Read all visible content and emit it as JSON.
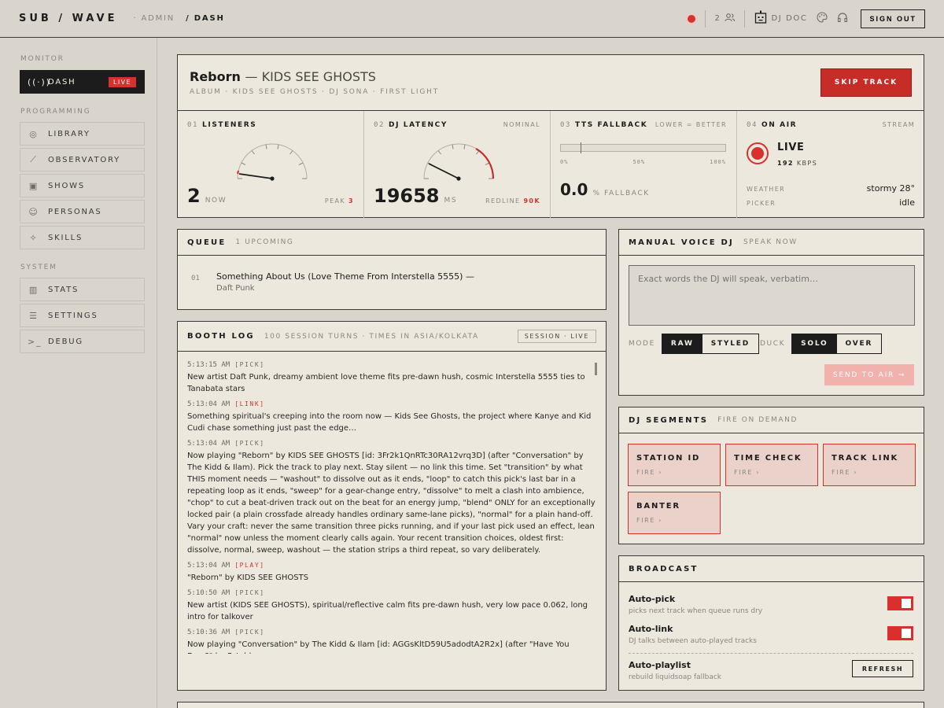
{
  "header": {
    "brand": "SUB / WAVE",
    "crumbs": [
      "· ADMIN",
      "/ DASH"
    ],
    "listener_count": "2",
    "dj_label": "DJ DOC",
    "sign_out": "SIGN OUT"
  },
  "sidebar": {
    "sections": [
      "MONITOR",
      "PROGRAMMING",
      "SYSTEM"
    ],
    "items": [
      {
        "label": "DASH",
        "icon": "broadcast-icon",
        "badge": "LIVE",
        "active": true
      },
      {
        "label": "LIBRARY",
        "icon": "vinyl-icon"
      },
      {
        "label": "OBSERVATORY",
        "icon": "telescope-icon"
      },
      {
        "label": "SHOWS",
        "icon": "calendar-icon"
      },
      {
        "label": "PERSONAS",
        "icon": "mask-icon"
      },
      {
        "label": "SKILLS",
        "icon": "sparkle-icon"
      },
      {
        "label": "STATS",
        "icon": "bar-chart-icon"
      },
      {
        "label": "SETTINGS",
        "icon": "sliders-icon"
      },
      {
        "label": "DEBUG",
        "icon": "terminal-icon"
      }
    ]
  },
  "now_playing": {
    "title": "Reborn",
    "artist": "— KIDS SEE GHOSTS",
    "meta": "ALBUM · KIDS SEE GHOSTS · DJ SONA · FIRST LIGHT",
    "skip_label": "SKIP TRACK"
  },
  "metrics": {
    "listeners": {
      "num": "01",
      "label": "LISTENERS",
      "value": "2",
      "unit": "NOW",
      "peak_label": "PEAK",
      "peak": "3"
    },
    "latency": {
      "num": "02",
      "label": "DJ LATENCY",
      "tag": "NOMINAL",
      "value": "19658",
      "unit": "MS",
      "redline_label": "REDLINE",
      "redline": "90K"
    },
    "tts": {
      "num": "03",
      "label": "TTS FALLBACK",
      "tag": "LOWER = BETTER",
      "ticks": [
        "0%",
        "50%",
        "100%"
      ],
      "value": "0.0",
      "unit": "% FALLBACK"
    },
    "onair": {
      "num": "04",
      "label": "ON AIR",
      "tag": "STREAM",
      "status": "LIVE",
      "kbps": "192",
      "kbps_unit": "KBPS",
      "weather_label": "WEATHER",
      "weather": "stormy 28°",
      "picker_label": "PICKER",
      "picker": "idle"
    }
  },
  "queue": {
    "title": "QUEUE",
    "sub": "1 UPCOMING",
    "items": [
      {
        "num": "01",
        "title": "Something About Us (Love Theme From Interstella 5555) —",
        "artist": "Daft Punk"
      }
    ]
  },
  "booth_log": {
    "title": "BOOTH LOG",
    "sub": "100 SESSION TURNS · TIMES IN ASIA/KOLKATA",
    "session_label": "SESSION · LIVE",
    "entries": [
      {
        "time": "5:13:15 AM",
        "kind": "[PICK]",
        "text": "New artist Daft Punk, dreamy ambient love theme fits pre-dawn hush, cosmic Interstella 5555 ties to Tanabata stars"
      },
      {
        "time": "5:13:04 AM",
        "kind": "[LINK]",
        "text": "Something spiritual's creeping into the room now — Kids See Ghosts, the project where Kanye and Kid Cudi chase something just past the edge…"
      },
      {
        "time": "5:13:04 AM",
        "kind": "[PICK]",
        "text": "Now playing \"Reborn\" by KIDS SEE GHOSTS [id: 3Fr2k1QnRTc30RA12vrq3D] (after \"Conversation\" by The Kidd & Ilam). Pick the track to play next. Stay silent — no link this time. Set \"transition\" by what THIS moment needs — \"washout\" to dissolve out as it ends, \"loop\" to catch this pick's last bar in a repeating loop as it ends, \"sweep\" for a gear-change entry, \"dissolve\" to melt a clash into ambience, \"chop\" to cut a beat-driven track out on the beat for an energy jump, \"blend\" ONLY for an exceptionally locked pair (a plain crossfade already handles ordinary same-lane picks), \"normal\" for a plain hand-off. Vary your craft: never the same transition three picks running, and if your last pick used an effect, lean \"normal\" now unless the moment clearly calls again. Your recent transition choices, oldest first: dissolve, normal, sweep, washout — the station strips a third repeat, so vary deliberately."
      },
      {
        "time": "5:13:04 AM",
        "kind": "[PLAY]",
        "text": "\"Reborn\" by KIDS SEE GHOSTS"
      },
      {
        "time": "5:10:50 AM",
        "kind": "[PICK]",
        "text": "New artist (KIDS SEE GHOSTS), spiritual/reflective calm fits pre-dawn hush, very low pace 0.062, long intro for talkover"
      },
      {
        "time": "5:10:36 AM",
        "kind": "[PICK]",
        "text": "Now playing \"Conversation\" by The Kidd & Ilam [id: AGGsKltD59U5adodtA2R2x] (after \"Have You Ever?\" by Fateh)"
      }
    ]
  },
  "voice_dj": {
    "title": "MANUAL VOICE DJ",
    "sub": "SPEAK NOW",
    "placeholder": "Exact words the DJ will speak, verbatim…",
    "mode_label": "MODE",
    "mode_options": [
      "RAW",
      "STYLED"
    ],
    "duck_label": "DUCK",
    "duck_options": [
      "SOLO",
      "OVER"
    ],
    "send_label": "SEND TO AIR →"
  },
  "segments": {
    "title": "DJ SEGMENTS",
    "sub": "FIRE ON DEMAND",
    "items": [
      {
        "label": "STATION ID",
        "fire": "FIRE ›"
      },
      {
        "label": "TIME CHECK",
        "fire": "FIRE ›"
      },
      {
        "label": "TRACK LINK",
        "fire": "FIRE ›"
      },
      {
        "label": "BANTER",
        "fire": "FIRE ›"
      }
    ]
  },
  "broadcast": {
    "title": "BROADCAST",
    "rows": [
      {
        "title": "Auto-pick",
        "sub": "picks next track when queue runs dry",
        "on": true
      },
      {
        "title": "Auto-link",
        "sub": "DJ talks between auto-played tracks",
        "on": true
      },
      {
        "title": "Auto-playlist",
        "sub": "rebuild liquidsoap fallback",
        "action": "REFRESH"
      }
    ]
  },
  "colors": {
    "accent": "#d8312d",
    "ink": "#1c1c1c",
    "paper": "#ece8de",
    "background": "#d9d5cc"
  }
}
